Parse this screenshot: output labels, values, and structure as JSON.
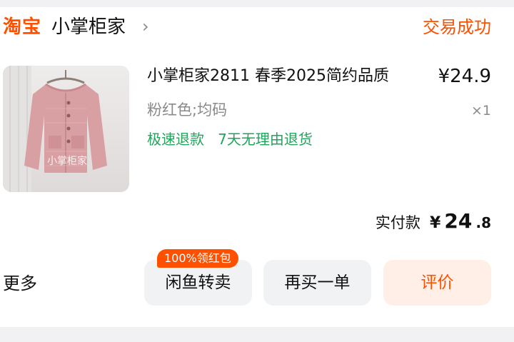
{
  "shop": {
    "logo_text": "淘宝",
    "name": "小掌柜家",
    "status": "交易成功"
  },
  "product": {
    "title": "小掌柜家2811 春季2025简约品质",
    "price": "¥24.9",
    "sku": "粉红色;均码",
    "quantity": "×1",
    "image_watermark": "小掌柜家",
    "service_tags": [
      "极速退款",
      "7天无理由退货"
    ]
  },
  "payment": {
    "label": "实付款",
    "currency": "¥",
    "amount_int": "24",
    "amount_dec": ".8"
  },
  "actions": {
    "more_label": "更多",
    "promo_badge": "100%领红包",
    "resell_label": "闲鱼转卖",
    "rebuy_label": "再买一单",
    "review_label": "评价"
  },
  "colors": {
    "brand_orange": "#ff5000",
    "service_green": "#21a35b",
    "review_bg": "#ffefe6"
  },
  "icons": {
    "shop_chevron": "chevron-right-icon"
  }
}
